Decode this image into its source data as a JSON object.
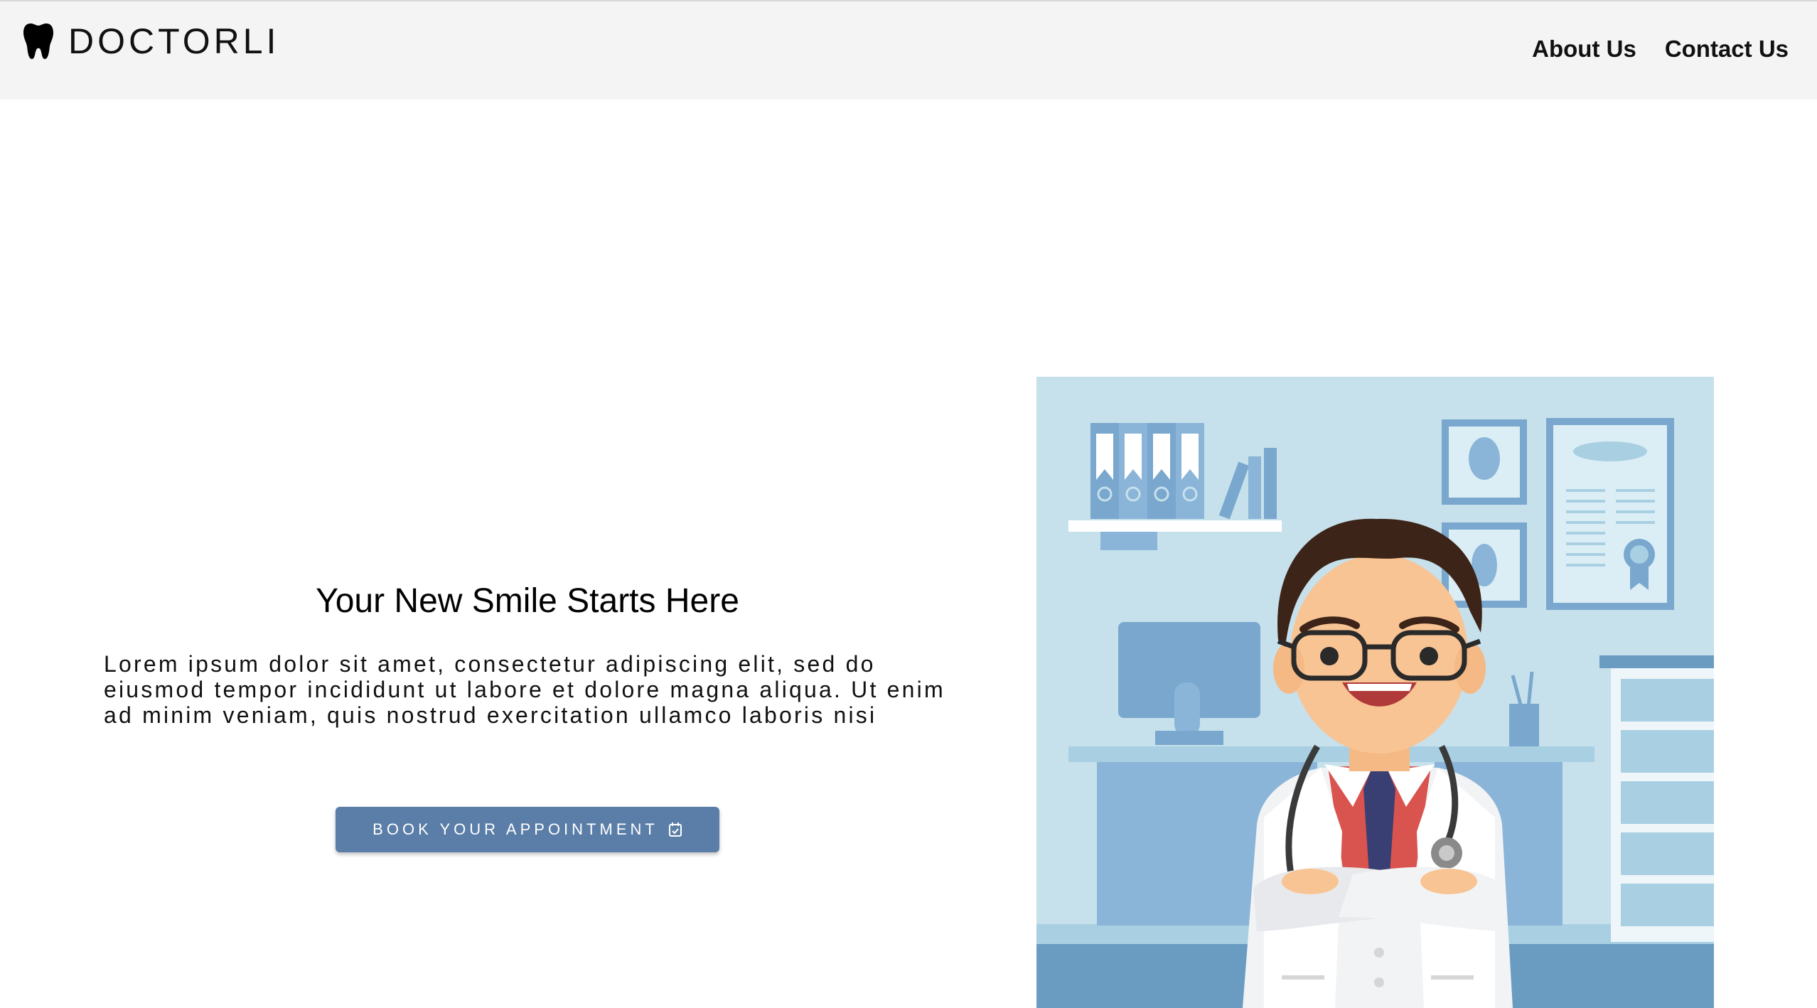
{
  "navbar": {
    "brand_name": "DOCTORLI",
    "brand_icon": "tooth-icon",
    "links": [
      {
        "label": "About Us"
      },
      {
        "label": "Contact Us"
      }
    ],
    "background": "#f4f4f4"
  },
  "hero": {
    "title": "Your New Smile Starts Here",
    "text": "Lorem ipsum dolor sit amet, consectetur adipiscing elit, sed do eiusmod tempor incididunt ut labore et dolore magna aliqua. Ut enim ad minim veniam, quis nostrud exercitation ullamco laboris nisi",
    "cta_label": "BOOK YOUR APPOINTMENT",
    "cta_icon": "calendar-check-icon",
    "cta_color": "#5b7ea8"
  },
  "illustration": {
    "subject": "doctor-illustration",
    "background": "#c6e1ec"
  }
}
